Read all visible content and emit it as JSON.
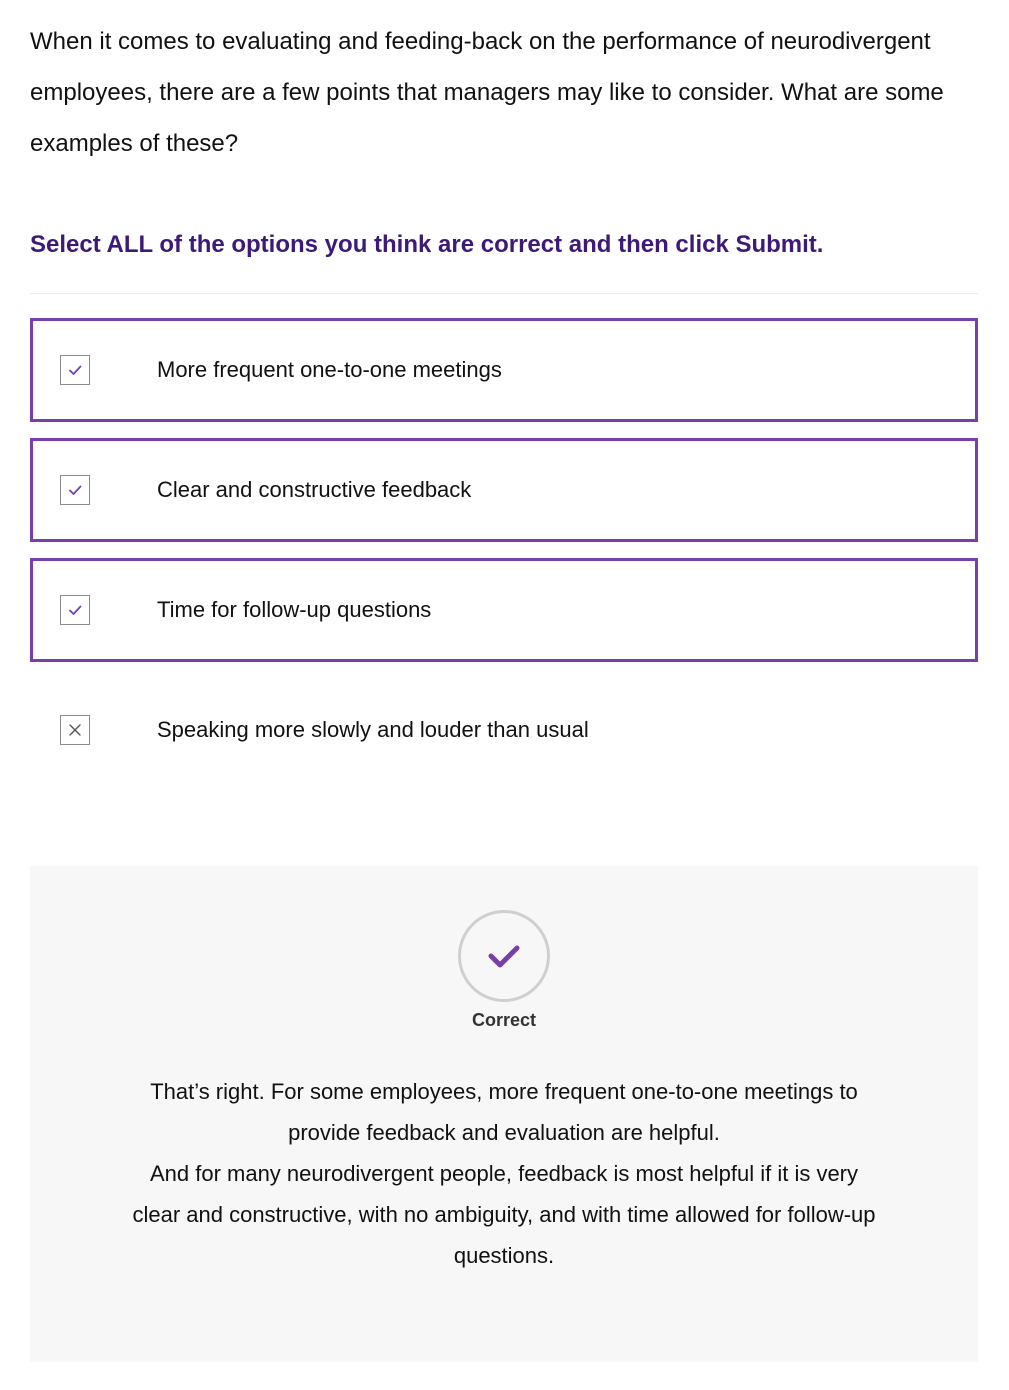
{
  "question": {
    "text": "When it comes to evaluating and feeding-back on the performance of neurodivergent employees, there are a few points that managers may like to consider. What are some examples of these?"
  },
  "instruction": {
    "text": "Select ALL of the options you think are correct and then click Submit."
  },
  "options": [
    {
      "label": "More frequent one-to-one meetings",
      "selected": true,
      "icon": "check-icon"
    },
    {
      "label": "Clear and constructive feedback",
      "selected": true,
      "icon": "check-icon"
    },
    {
      "label": "Time for follow-up questions",
      "selected": true,
      "icon": "check-icon"
    },
    {
      "label": "Speaking more slowly and louder than usual",
      "selected": false,
      "icon": "cross-icon"
    }
  ],
  "feedback": {
    "status_label": "Correct",
    "status_icon": "checkmark-circle-icon",
    "line1": "That’s right. For some employees, more frequent one-to-one meetings to provide feedback and evaluation are helpful.",
    "line2": "And for many neurodivergent people, feedback is most helpful if it is very clear and constructive, with no ambiguity, and with time allowed for follow-up questions."
  },
  "colors": {
    "accent": "#7a3ea8",
    "instruction": "#3d1a78",
    "feedback_background": "#f7f7f7"
  }
}
